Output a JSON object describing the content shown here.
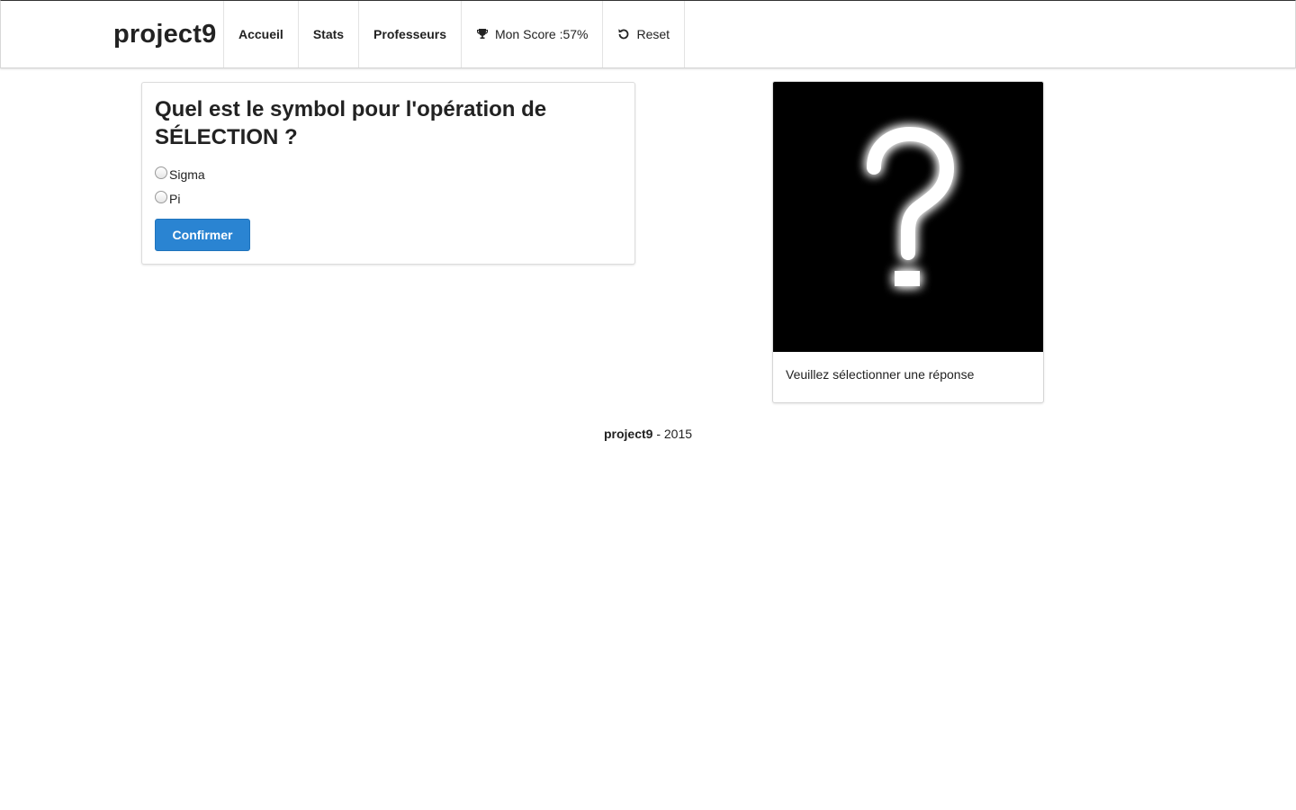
{
  "navbar": {
    "brand": "project9",
    "items": [
      {
        "label": "Accueil"
      },
      {
        "label": "Stats"
      },
      {
        "label": "Professeurs"
      },
      {
        "label": "Mon Score :57%",
        "icon": "trophy-icon"
      },
      {
        "label": "Reset",
        "icon": "refresh-icon"
      }
    ]
  },
  "question": {
    "title": "Quel est le symbol pour l'opération de SÉLECTION ?",
    "options": [
      {
        "label": "Sigma",
        "checked": false
      },
      {
        "label": "Pi",
        "checked": false
      }
    ],
    "confirm_label": "Confirmer"
  },
  "image_card": {
    "image_icon": "question-mark-icon",
    "caption": "Veuillez sélectionner une réponse"
  },
  "footer": {
    "brand": "project9",
    "year_text": " - 2015"
  },
  "colors": {
    "primary_button": "#2a84d2",
    "image_background": "#000000"
  }
}
